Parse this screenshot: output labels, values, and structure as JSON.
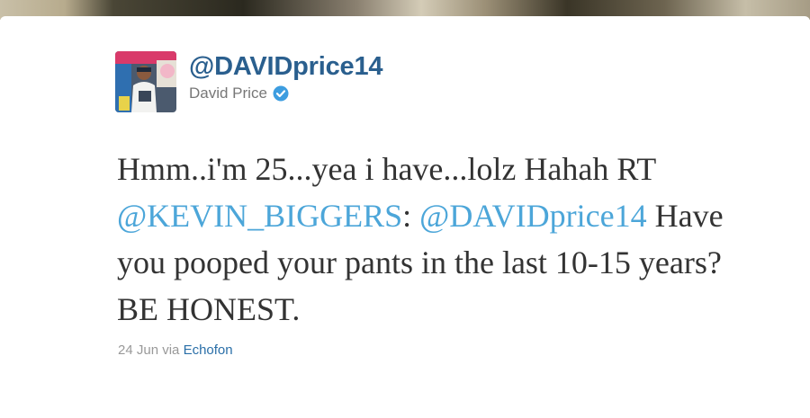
{
  "tweet": {
    "handle": "@DAVIDprice14",
    "display_name": "David Price",
    "verified_icon": "verified-badge-icon",
    "text_part1": "Hmm..i'm 25...yea i have...lolz Hahah RT ",
    "mention1": "@KEVIN_BIGGERS",
    "colon": ": ",
    "mention2": "@DAVIDprice14",
    "text_part2": " Have you pooped your pants in the last 10-15 years? BE HONEST.",
    "date": "24 Jun",
    "via": " via ",
    "source": "Echofon"
  },
  "colors": {
    "handle": "#2a5f8e",
    "mention": "#4ca6d9",
    "body_text": "#333333",
    "meta_text": "#999999",
    "verified": "#3d9de0"
  }
}
